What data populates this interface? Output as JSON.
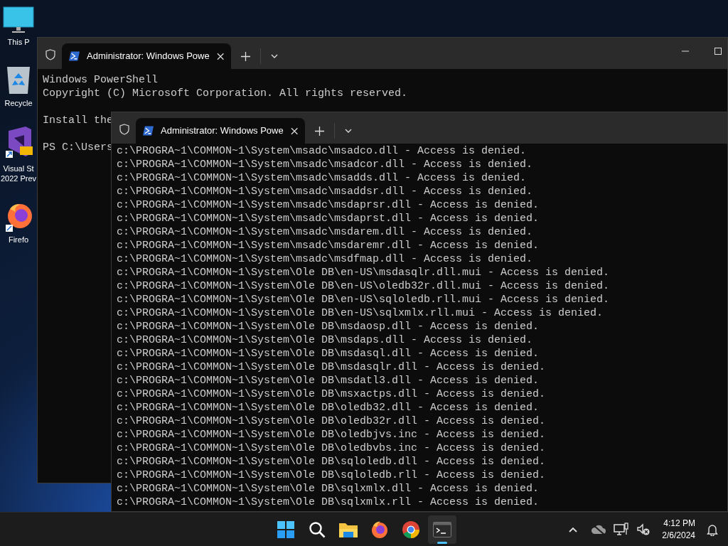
{
  "desktop_icons": [
    {
      "kind": "monitor",
      "label": "This P"
    },
    {
      "kind": "recycle",
      "label": "Recycle"
    },
    {
      "kind": "vs",
      "label": "Visual St\n2022 Prev"
    },
    {
      "kind": "firefox",
      "label": "Firefo"
    }
  ],
  "windows": [
    {
      "tabs": [
        {
          "title": "Administrator: Windows Powe",
          "selected": true
        }
      ],
      "blocks": [
        [
          "Windows PowerShell",
          "Copyright (C) Microsoft Corporation. All rights reserved."
        ],
        [
          "Install the"
        ],
        [
          "PS C:\\Users"
        ]
      ]
    },
    {
      "tabs": [
        {
          "title": "Administrator: Windows Powe",
          "selected": true
        }
      ],
      "blocks": [
        [
          "c:\\PROGRA~1\\COMMON~1\\System\\msadc\\msadco.dll - Access is denied.",
          "c:\\PROGRA~1\\COMMON~1\\System\\msadc\\msadcor.dll - Access is denied.",
          "c:\\PROGRA~1\\COMMON~1\\System\\msadc\\msadds.dll - Access is denied.",
          "c:\\PROGRA~1\\COMMON~1\\System\\msadc\\msaddsr.dll - Access is denied.",
          "c:\\PROGRA~1\\COMMON~1\\System\\msadc\\msdaprsr.dll - Access is denied.",
          "c:\\PROGRA~1\\COMMON~1\\System\\msadc\\msdaprst.dll - Access is denied.",
          "c:\\PROGRA~1\\COMMON~1\\System\\msadc\\msdarem.dll - Access is denied.",
          "c:\\PROGRA~1\\COMMON~1\\System\\msadc\\msdaremr.dll - Access is denied.",
          "c:\\PROGRA~1\\COMMON~1\\System\\msadc\\msdfmap.dll - Access is denied.",
          "c:\\PROGRA~1\\COMMON~1\\System\\Ole DB\\en-US\\msdasqlr.dll.mui - Access is denied.",
          "c:\\PROGRA~1\\COMMON~1\\System\\Ole DB\\en-US\\oledb32r.dll.mui - Access is denied.",
          "c:\\PROGRA~1\\COMMON~1\\System\\Ole DB\\en-US\\sqloledb.rll.mui - Access is denied.",
          "c:\\PROGRA~1\\COMMON~1\\System\\Ole DB\\en-US\\sqlxmlx.rll.mui - Access is denied.",
          "c:\\PROGRA~1\\COMMON~1\\System\\Ole DB\\msdaosp.dll - Access is denied.",
          "c:\\PROGRA~1\\COMMON~1\\System\\Ole DB\\msdaps.dll - Access is denied.",
          "c:\\PROGRA~1\\COMMON~1\\System\\Ole DB\\msdasql.dll - Access is denied.",
          "c:\\PROGRA~1\\COMMON~1\\System\\Ole DB\\msdasqlr.dll - Access is denied.",
          "c:\\PROGRA~1\\COMMON~1\\System\\Ole DB\\msdatl3.dll - Access is denied.",
          "c:\\PROGRA~1\\COMMON~1\\System\\Ole DB\\msxactps.dll - Access is denied.",
          "c:\\PROGRA~1\\COMMON~1\\System\\Ole DB\\oledb32.dll - Access is denied.",
          "c:\\PROGRA~1\\COMMON~1\\System\\Ole DB\\oledb32r.dll - Access is denied.",
          "c:\\PROGRA~1\\COMMON~1\\System\\Ole DB\\oledbjvs.inc - Access is denied.",
          "c:\\PROGRA~1\\COMMON~1\\System\\Ole DB\\oledbvbs.inc - Access is denied.",
          "c:\\PROGRA~1\\COMMON~1\\System\\Ole DB\\sqloledb.dll - Access is denied.",
          "c:\\PROGRA~1\\COMMON~1\\System\\Ole DB\\sqloledb.rll - Access is denied.",
          "c:\\PROGRA~1\\COMMON~1\\System\\Ole DB\\sqlxmlx.dll - Access is denied.",
          "c:\\PROGRA~1\\COMMON~1\\System\\Ole DB\\sqlxmlx.rll - Access is denied."
        ]
      ]
    }
  ],
  "taskbar": {
    "apps": [
      {
        "kind": "start",
        "active": false
      },
      {
        "kind": "search",
        "active": false
      },
      {
        "kind": "explorer",
        "active": false
      },
      {
        "kind": "firefox",
        "active": false
      },
      {
        "kind": "chrome",
        "active": false
      },
      {
        "kind": "terminal",
        "active": true
      }
    ],
    "clock": {
      "time": "4:12 PM",
      "date": "2/6/2024"
    }
  }
}
